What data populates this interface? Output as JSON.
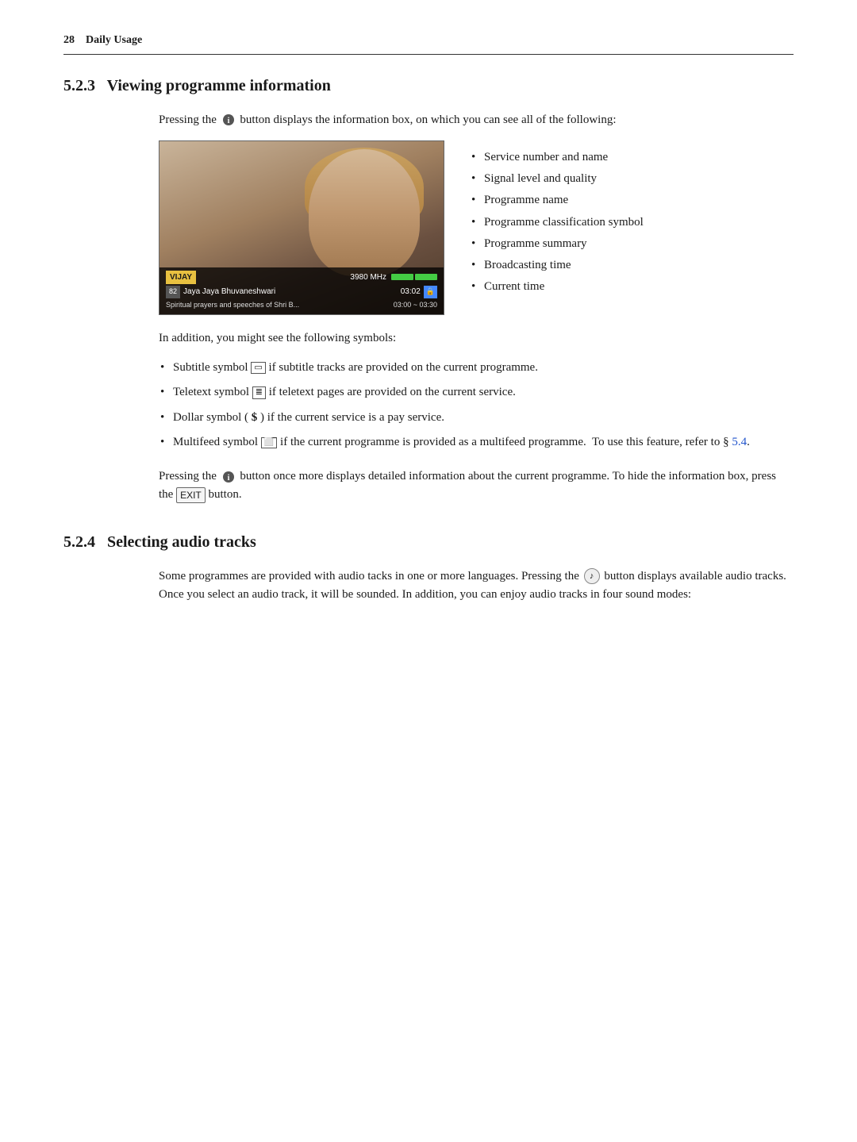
{
  "header": {
    "page_number": "28",
    "chapter": "Daily Usage"
  },
  "section_523": {
    "number": "5.2.3",
    "title": "Viewing programme information",
    "intro_para": "Pressing the",
    "intro_para2": "button displays the information box, on which you can see all of the following:",
    "info_list": {
      "items": [
        "Service number and name",
        "Signal level and quality",
        "Programme name",
        "Programme classification symbol",
        "Programme summary",
        "Broadcasting time",
        "Current time"
      ]
    },
    "screenshot": {
      "channel_label": "VIJAY",
      "freq_label": "3980 MHz",
      "num_label": "82",
      "channel_name": "Jaya Jaya Bhuvaneshwari",
      "time_label": "03:02",
      "summary_text": "Spiritual prayers and speeches of Shri B...",
      "time_range": "03:00 ~ 03:30"
    },
    "additional_symbols_intro": "In addition, you might see the following symbols:",
    "additional_symbols": [
      {
        "symbol": "□",
        "label": "Subtitle symbol",
        "description": "if subtitle tracks are provided on the current programme."
      },
      {
        "symbol": "≡",
        "label": "Teletext symbol",
        "description": "if teletext pages are provided on the current service."
      },
      {
        "symbol": "$",
        "label": "Dollar symbol",
        "description": "if the current service is a pay service."
      },
      {
        "symbol": "⧉",
        "label": "Multifeed symbol",
        "description": "if the current programme is provided as a multifeed programme. To use this feature, refer to §"
      }
    ],
    "multifeed_link": "5.4",
    "closing_para1": "Pressing the",
    "closing_para2": "button once more displays detailed information about the current programme. To hide the information box, press the",
    "closing_para3": "button.",
    "exit_label": "EXIT"
  },
  "section_524": {
    "number": "5.2.4",
    "title": "Selecting audio tracks",
    "para": "Some programmes are provided with audio tacks in one or more languages. Pressing the",
    "para2": "button displays available audio tracks. Once you select an audio track, it will be sounded. In addition, you can enjoy audio tracks in four sound modes:"
  }
}
